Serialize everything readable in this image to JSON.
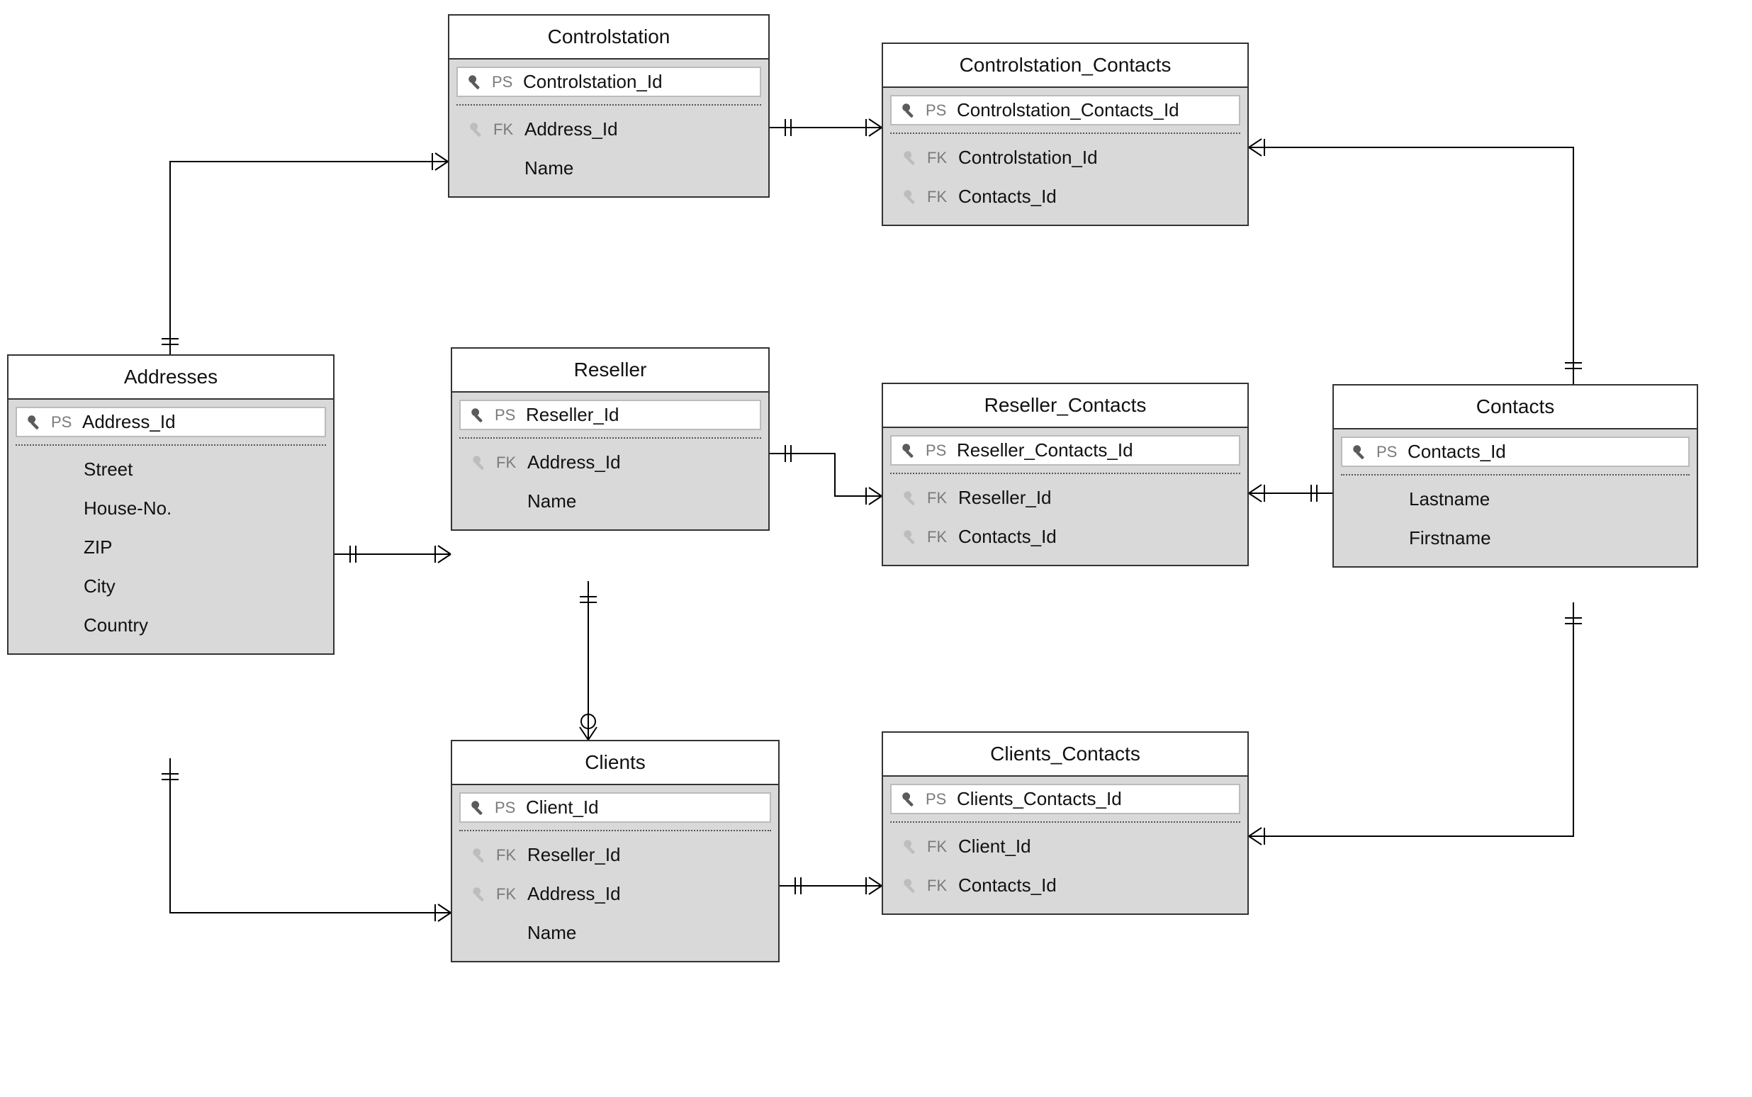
{
  "keyTags": {
    "ps": "PS",
    "fk": "FK"
  },
  "entities": {
    "controlstation": {
      "title": "Controlstation",
      "pk": {
        "name": "Controlstation_Id"
      },
      "rows": [
        {
          "kind": "fk",
          "name": "Address_Id"
        },
        {
          "kind": "plain",
          "name": "Name"
        }
      ]
    },
    "controlstation_contacts": {
      "title": "Controlstation_Contacts",
      "pk": {
        "name": "Controlstation_Contacts_Id"
      },
      "rows": [
        {
          "kind": "fk",
          "name": "Controlstation_Id"
        },
        {
          "kind": "fk",
          "name": "Contacts_Id"
        }
      ]
    },
    "addresses": {
      "title": "Addresses",
      "pk": {
        "name": "Address_Id"
      },
      "rows": [
        {
          "kind": "plain",
          "name": "Street"
        },
        {
          "kind": "plain",
          "name": "House-No."
        },
        {
          "kind": "plain",
          "name": "ZIP"
        },
        {
          "kind": "plain",
          "name": "City"
        },
        {
          "kind": "plain",
          "name": "Country"
        }
      ]
    },
    "reseller": {
      "title": "Reseller",
      "pk": {
        "name": "Reseller_Id"
      },
      "rows": [
        {
          "kind": "fk",
          "name": "Address_Id"
        },
        {
          "kind": "plain",
          "name": "Name"
        }
      ]
    },
    "reseller_contacts": {
      "title": "Reseller_Contacts",
      "pk": {
        "name": "Reseller_Contacts_Id"
      },
      "rows": [
        {
          "kind": "fk",
          "name": "Reseller_Id"
        },
        {
          "kind": "fk",
          "name": "Contacts_Id"
        }
      ]
    },
    "contacts": {
      "title": "Contacts",
      "pk": {
        "name": "Contacts_Id"
      },
      "rows": [
        {
          "kind": "plain",
          "name": "Lastname"
        },
        {
          "kind": "plain",
          "name": "Firstname"
        }
      ]
    },
    "clients": {
      "title": "Clients",
      "pk": {
        "name": "Client_Id"
      },
      "rows": [
        {
          "kind": "fk",
          "name": "Reseller_Id"
        },
        {
          "kind": "fk",
          "name": "Address_Id"
        },
        {
          "kind": "plain",
          "name": "Name"
        }
      ]
    },
    "clients_contacts": {
      "title": "Clients_Contacts",
      "pk": {
        "name": "Clients_Contacts_Id"
      },
      "rows": [
        {
          "kind": "fk",
          "name": "Client_Id"
        },
        {
          "kind": "fk",
          "name": "Contacts_Id"
        }
      ]
    }
  }
}
